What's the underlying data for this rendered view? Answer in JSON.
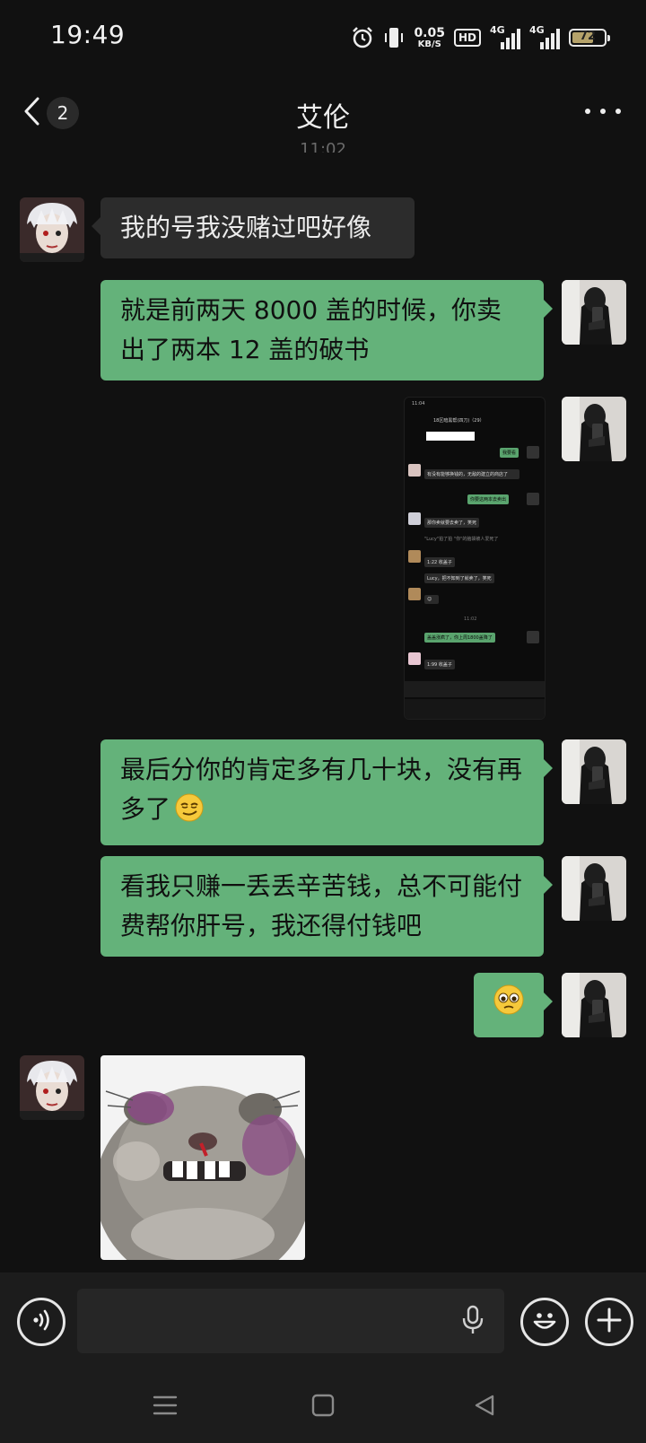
{
  "status_bar": {
    "time": "19:49",
    "net_speed_value": "0.05",
    "net_speed_unit": "KB/S",
    "hd_label": "HD",
    "signal1_label": "4G",
    "signal2_label": "4G",
    "battery_percent": "72",
    "battery_level": 0.72,
    "icons": [
      "alarm-icon",
      "vibrate-icon",
      "hd-voice-icon",
      "signal-icon",
      "signal-icon",
      "battery-icon"
    ]
  },
  "header": {
    "title": "艾伦",
    "back_icon": "chevron-left-icon",
    "unread_count": "2",
    "more_icon": "more-dots-icon"
  },
  "time_separator": "11:02",
  "messages": [
    {
      "side": "received",
      "type": "text",
      "text": "我的号我没赌过吧好像"
    },
    {
      "side": "sent",
      "type": "text",
      "text": "就是前两天 8000 盖的时候，你卖出了两本 12 盖的破书"
    },
    {
      "side": "sent",
      "type": "image",
      "description": "chat screenshot"
    },
    {
      "side": "sent",
      "type": "text",
      "text": "最后分你的肯定多有几十块，没有再多了",
      "emoji": "smirk-emoji"
    },
    {
      "side": "sent",
      "type": "text",
      "text": "看我只赚一丢丢辛苦钱，总不可能付费帮你肝号，我还得付钱吧"
    },
    {
      "side": "sent",
      "type": "emoji",
      "emoji": "pleading-emoji"
    },
    {
      "side": "received",
      "type": "sticker",
      "description": "hamster sticker"
    }
  ],
  "screenshot": {
    "time": "11:04",
    "group_title": "18区暗黑帮(四刀)（29）",
    "lines": [
      "我要看",
      "有没有能够换钱的，无敌的建立的商店了",
      "你要这两本去卖出",
      "那你卖就要去卖了，笑死",
      "\"Lucy\"拍了拍 \"你\"的脑袋被人爱死了",
      "1:22 收盖子",
      "Lucy，把不知到了就卖了，笑死",
      "11:02",
      "盖盖涨疯了，你上周1800盖降了",
      "1:99 收盖子"
    ]
  },
  "input_bar": {
    "placeholder": "",
    "voice_icon": "voice-icon",
    "mic_icon": "mic-icon",
    "emoji_icon": "smiley-icon",
    "plus_icon": "plus-icon"
  },
  "nav_bar": {
    "icons": [
      "menu-icon",
      "home-icon",
      "back-triangle-icon"
    ]
  },
  "colors": {
    "background": "#111111",
    "sent_bubble": "#64b27a",
    "received_bubble": "#2c2c2c",
    "bar_background": "#1c1c1c"
  }
}
